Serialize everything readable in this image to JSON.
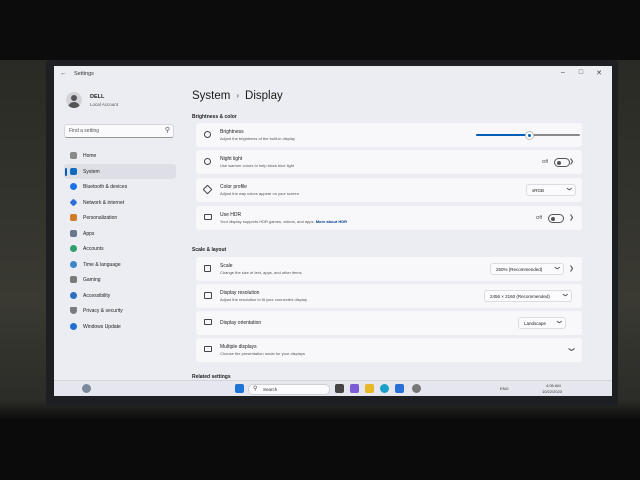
{
  "window": {
    "title": "Settings",
    "back_glyph": "←",
    "minimize_glyph": "–",
    "maximize_glyph": "□",
    "close_glyph": "✕"
  },
  "user": {
    "name": "DELL",
    "account_type": "Local Account"
  },
  "search": {
    "placeholder": "Find a setting",
    "icon": "search-icon"
  },
  "sidebar": {
    "items": [
      {
        "label": "Home",
        "icon": "home-icon",
        "color": "#8a8a8a"
      },
      {
        "label": "System",
        "icon": "system-icon",
        "color": "#0f6cbd",
        "active": true
      },
      {
        "label": "Bluetooth & devices",
        "icon": "bluetooth-icon",
        "color": "#1a73e8"
      },
      {
        "label": "Network & internet",
        "icon": "network-icon",
        "color": "#2b6ed6"
      },
      {
        "label": "Personalization",
        "icon": "brush-icon",
        "color": "#d07a2a"
      },
      {
        "label": "Apps",
        "icon": "apps-icon",
        "color": "#6a7a8c"
      },
      {
        "label": "Accounts",
        "icon": "accounts-icon",
        "color": "#2e9f6a"
      },
      {
        "label": "Time & language",
        "icon": "time-icon",
        "color": "#3a86c8"
      },
      {
        "label": "Gaming",
        "icon": "gaming-icon",
        "color": "#7a7a7a"
      },
      {
        "label": "Accessibility",
        "icon": "accessibility-icon",
        "color": "#2a6fc0"
      },
      {
        "label": "Privacy & security",
        "icon": "shield-icon",
        "color": "#7a7a85"
      },
      {
        "label": "Windows Update",
        "icon": "update-icon",
        "color": "#1f6fd0"
      }
    ]
  },
  "breadcrumb": {
    "parent": "System",
    "separator": "›",
    "current": "Display"
  },
  "sections": {
    "brightness_color": "Brightness & color",
    "scale_layout": "Scale & layout",
    "related": "Related settings"
  },
  "settings": {
    "brightness": {
      "title": "Brightness",
      "subtitle": "Adjust the brightness of the built-in display",
      "level": 0.5
    },
    "night_light": {
      "title": "Night light",
      "subtitle": "Use warmer colors to help block blue light",
      "state": "Off"
    },
    "color_profile": {
      "title": "Color profile",
      "subtitle": "Adjust the way colors appear on your screen",
      "value": "sRGB"
    },
    "hdr": {
      "title": "Use HDR",
      "subtitle": "Your display supports HDR games, videos, and apps.",
      "link": "More about HDR",
      "state": "Off"
    },
    "scale": {
      "title": "Scale",
      "subtitle": "Change the size of text, apps, and other items",
      "value": "250% (Recommended)"
    },
    "resolution": {
      "title": "Display resolution",
      "subtitle": "Adjust the resolution to fit your connected display",
      "value": "2456 × 2160 (Recommended)"
    },
    "orientation": {
      "title": "Display orientation",
      "value": "Landscape"
    },
    "multiple": {
      "title": "Multiple displays",
      "subtitle": "Choose the presentation mode for your displays"
    }
  },
  "taskbar": {
    "search_label": "Search",
    "icons": [
      "widgets-icon",
      "start-icon",
      "task-view-icon",
      "chat-icon",
      "file-explorer-icon",
      "edge-icon",
      "store-icon",
      "settings-icon"
    ],
    "tray_text": "ENG",
    "clock_time": "4:05 AM",
    "clock_date": "10/22/2023"
  },
  "colors": {
    "accent": "#005fb8"
  }
}
